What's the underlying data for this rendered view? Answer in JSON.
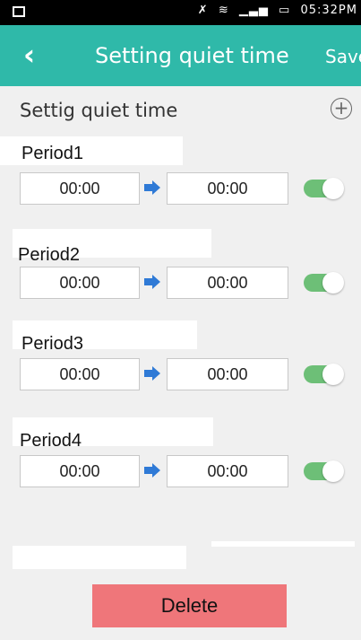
{
  "status_bar": {
    "time": "05:32PM",
    "icons": [
      "image-icon",
      "mute-icon",
      "wifi-icon",
      "signal-icon",
      "battery-icon"
    ]
  },
  "app_bar": {
    "back_icon": "chevron-left-icon",
    "title": "Setting quiet time",
    "save_label": "Save",
    "color": "#2fb9a9"
  },
  "header": {
    "label": "Settig quiet time",
    "add_icon": "plus-circle-icon"
  },
  "periods": [
    {
      "label": "Period1",
      "start": "00:00",
      "end": "00:00",
      "enabled": true
    },
    {
      "label": "Period2",
      "start": "00:00",
      "end": "00:00",
      "enabled": true
    },
    {
      "label": "Period3",
      "start": "00:00",
      "end": "00:00",
      "enabled": true
    },
    {
      "label": "Period4",
      "start": "00:00",
      "end": "00:00",
      "enabled": true
    }
  ],
  "delete_label": "Delete",
  "colors": {
    "toggle_on": "#6dbf77",
    "arrow": "#2f7ad6",
    "delete_bg": "#ef767a"
  }
}
